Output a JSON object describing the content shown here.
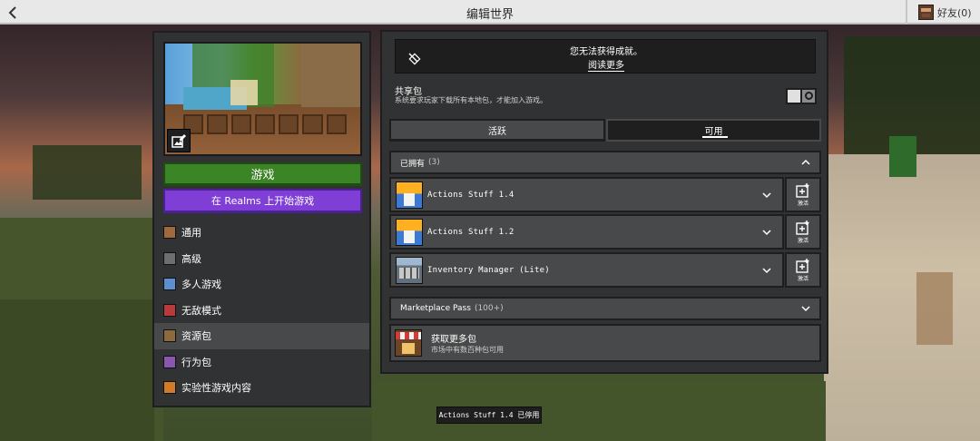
{
  "topbar": {
    "back_icon": "chevron-left-icon",
    "title": "编辑世界",
    "friends_label": "好友(0)"
  },
  "world": {
    "play_label": "游戏",
    "realms_label": "在 Realms 上开始游戏"
  },
  "nav": {
    "items": [
      {
        "label": "通用",
        "icon": "general-icon",
        "color": "#9c6a3c"
      },
      {
        "label": "高级",
        "icon": "advanced-icon",
        "color": "#6e6e6e"
      },
      {
        "label": "多人游戏",
        "icon": "multiplayer-icon",
        "color": "#5b8fd0"
      },
      {
        "label": "无敌模式",
        "icon": "cheats-icon",
        "color": "#b83a3a"
      },
      {
        "label": "资源包",
        "icon": "resource-pack-icon",
        "color": "#8a6a3e"
      },
      {
        "label": "行为包",
        "icon": "behavior-pack-icon",
        "color": "#8a56b0"
      },
      {
        "label": "实验性游戏内容",
        "icon": "experiments-icon",
        "color": "#d07a2a"
      }
    ],
    "active_index": 4
  },
  "notice": {
    "text": "您无法获得成就。",
    "link": "阅读更多"
  },
  "shared_packs": {
    "title": "共享包",
    "description": "系统要求玩家下载所有本地包，才能加入游戏。",
    "toggle_on": false
  },
  "tabs": {
    "active_label": "活跃",
    "available_label": "可用",
    "selected": "available"
  },
  "owned": {
    "label": "已拥有",
    "count": "(3)",
    "expanded": true,
    "packs": [
      {
        "name": "Actions Stuff 1.4",
        "icon": "actions-stuff-pack-icon",
        "activate_label": "激活"
      },
      {
        "name": "Actions Stuff 1.2",
        "icon": "actions-stuff-pack-icon",
        "activate_label": "激活"
      },
      {
        "name": "Inventory Manager (Lite)",
        "icon": "inventory-manager-pack-icon",
        "activate_label": "激活"
      }
    ]
  },
  "marketplace": {
    "label": "Marketplace Pass",
    "count": "(100+)",
    "expanded": false
  },
  "get_more": {
    "title": "获取更多包",
    "description": "市场中有数百种包可用"
  },
  "toast": {
    "text": "Actions  Stuff 1.4 已停用"
  },
  "colors": {
    "play_green": "#3c8527",
    "realms_purple": "#7f3fd6",
    "panel_dark": "#313233",
    "row_gray": "#48494a"
  }
}
